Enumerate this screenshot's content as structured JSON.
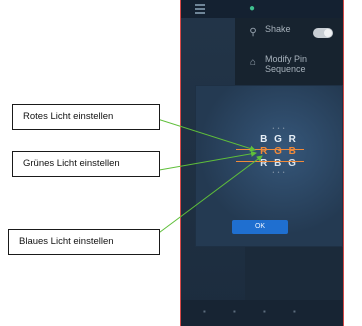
{
  "callouts": {
    "red": "Rotes Licht einstellen",
    "green": "Grünes Licht einstellen",
    "blue": "Blaues Licht einstellen"
  },
  "drawer": {
    "shake_label": "Shake",
    "modify_label_line1": "Modify Pin",
    "modify_label_line2": "Sequence"
  },
  "dialog": {
    "options_faint_top": "• • •",
    "option_1": "B G R",
    "option_2": "R G B",
    "option_3": "R B G",
    "options_faint_bottom": "• • •",
    "ok_label": "OK"
  },
  "colors": {
    "accent_orange": "#f08a3a",
    "arrow_green": "#5fbf3a",
    "ok_blue": "#1f6fd0"
  },
  "icons": {
    "menu": "menu-icon",
    "settings": "settings-icon",
    "shake": "shake-icon",
    "home": "home-icon"
  }
}
